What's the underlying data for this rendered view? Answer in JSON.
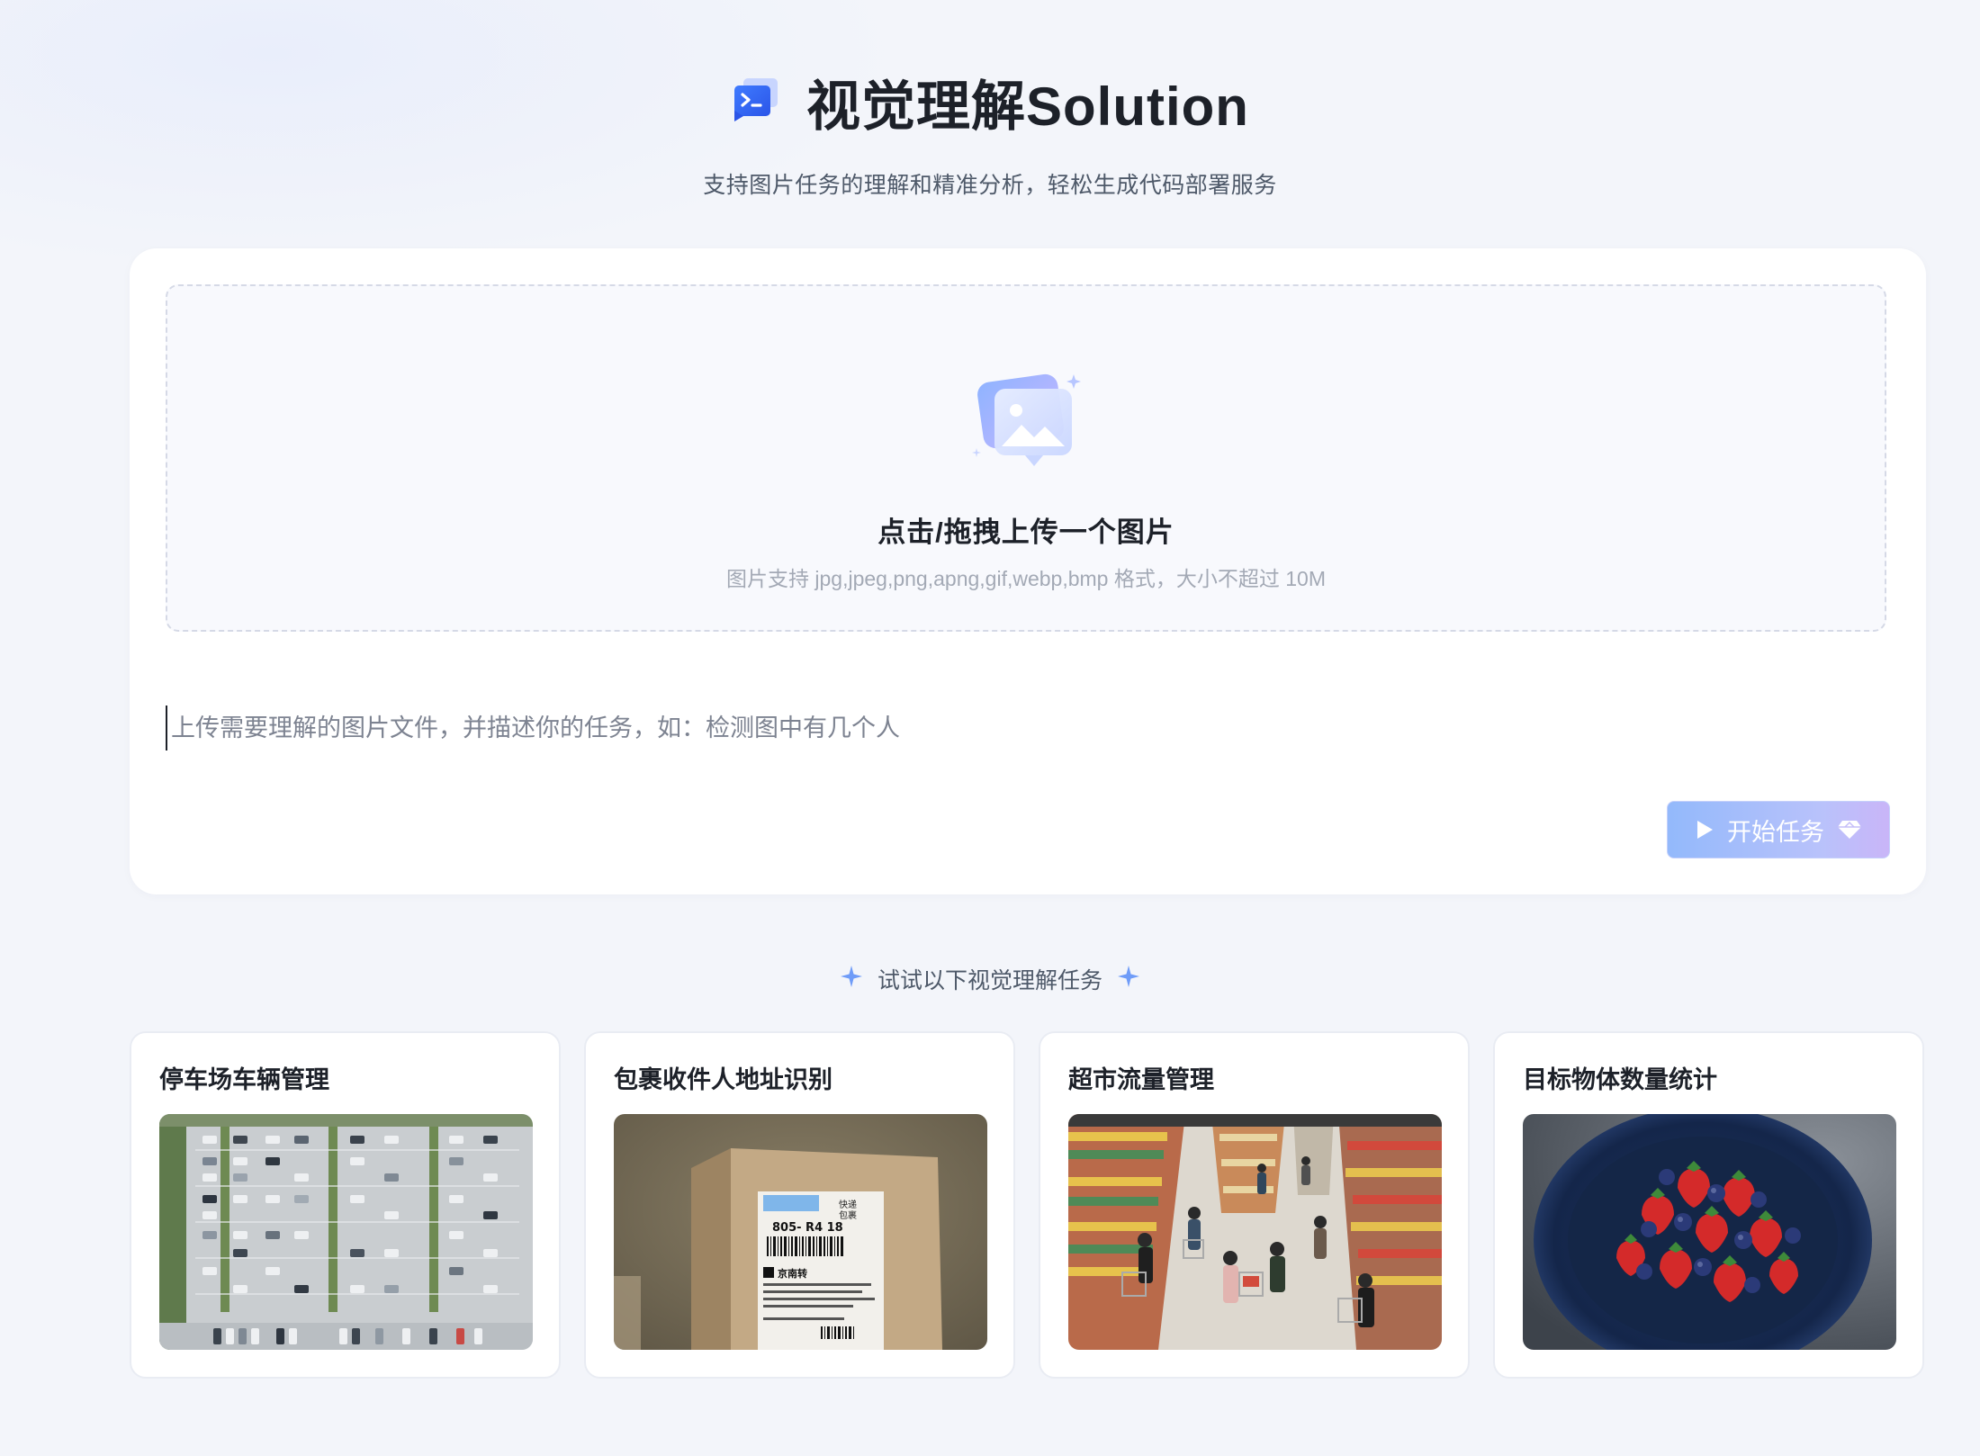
{
  "header": {
    "title": "视觉理解Solution",
    "subtitle": "支持图片任务的理解和精准分析，轻松生成代码部署服务",
    "icon": "terminal-icon"
  },
  "upload": {
    "title": "点击/拖拽上传一个图片",
    "hint": "图片支持 jpg,jpeg,png,apng,gif,webp,bmp 格式，大小不超过 10M",
    "icon": "image-upload-icon"
  },
  "task_input": {
    "placeholder": "上传需要理解的图片文件，并描述你的任务，如：检测图中有几个人",
    "value": ""
  },
  "start_button": {
    "label": "开始任务",
    "icon_left": "play-icon",
    "icon_right": "gem-icon"
  },
  "examples": {
    "heading": "试试以下视觉理解任务",
    "heading_icon": "sparkle-icon",
    "cards": [
      {
        "title": "停车场车辆管理",
        "image": "parking-lot-aerial"
      },
      {
        "title": "包裹收件人地址识别",
        "image": "package-label",
        "label_lines": [
          "805- R4 18",
          "京南转",
          "快递",
          "包裹"
        ]
      },
      {
        "title": "超市流量管理",
        "image": "supermarket-aisle"
      },
      {
        "title": "目标物体数量统计",
        "image": "berries-bowl"
      }
    ]
  },
  "colors": {
    "background": "#f3f5fa",
    "card": "#ffffff",
    "accent_blue": "#3b6cf6",
    "button_gradient_start": "#93b9fb",
    "button_gradient_end": "#c9b5f8",
    "text_primary": "#1d2129",
    "text_secondary": "#4e5969",
    "text_hint": "#a3a9b5"
  }
}
